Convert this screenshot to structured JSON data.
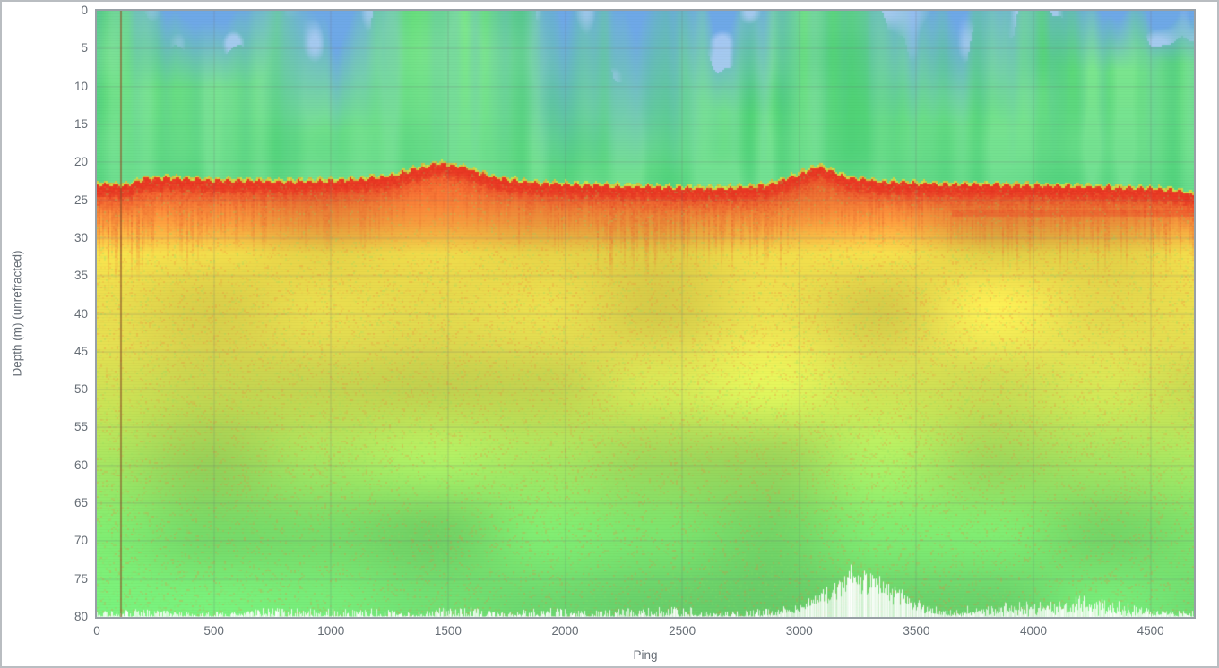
{
  "page": {
    "background": "#ffffff",
    "border_color": "#b9bdc1"
  },
  "chart_data": {
    "type": "heatmap",
    "subtype": "sonar-echogram",
    "title": "",
    "xlabel": "Ping",
    "ylabel": "Depth (m) (unrefracted)",
    "xlim": [
      0,
      4685
    ],
    "ylim": [
      0,
      80
    ],
    "y_axis_inverted": true,
    "grid": true,
    "legend": null,
    "x_ticks": [
      0,
      500,
      1000,
      1500,
      2000,
      2500,
      3000,
      3500,
      4000,
      4500
    ],
    "y_ticks": [
      0,
      5,
      10,
      15,
      20,
      25,
      30,
      35,
      40,
      45,
      50,
      55,
      60,
      65,
      70,
      75,
      80
    ],
    "marker_line": {
      "ping": 103,
      "color": "rgba(140,82,40,0.6)"
    },
    "seabed_profile": [
      [
        0,
        22.6
      ],
      [
        120,
        22.9
      ],
      [
        200,
        22.0
      ],
      [
        300,
        21.8
      ],
      [
        450,
        22.1
      ],
      [
        700,
        22.3
      ],
      [
        900,
        22.3
      ],
      [
        1100,
        22.1
      ],
      [
        1250,
        21.6
      ],
      [
        1450,
        19.9
      ],
      [
        1560,
        20.4
      ],
      [
        1700,
        21.9
      ],
      [
        1900,
        22.6
      ],
      [
        2100,
        22.8
      ],
      [
        2300,
        23.0
      ],
      [
        2500,
        23.2
      ],
      [
        2700,
        23.2
      ],
      [
        2850,
        22.9
      ],
      [
        2950,
        21.9
      ],
      [
        3080,
        20.3
      ],
      [
        3200,
        21.8
      ],
      [
        3350,
        22.4
      ],
      [
        3600,
        22.7
      ],
      [
        3900,
        22.8
      ],
      [
        4200,
        23.0
      ],
      [
        4450,
        23.2
      ],
      [
        4600,
        23.5
      ],
      [
        4685,
        24.0
      ]
    ],
    "water_blue_zones": [
      {
        "ping": 460,
        "sigma": 290,
        "reach_m": 10
      },
      {
        "ping": 995,
        "sigma": 210,
        "reach_m": 16
      },
      {
        "ping": 2160,
        "sigma": 360,
        "reach_m": 22
      },
      {
        "ping": 2680,
        "sigma": 230,
        "reach_m": 14
      },
      {
        "ping": 3615,
        "sigma": 325,
        "reach_m": 15
      },
      {
        "ping": 4290,
        "sigma": 230,
        "reach_m": 8
      },
      {
        "ping": 4590,
        "sigma": 310,
        "reach_m": 7
      }
    ],
    "subbottom_intensity_zones": [
      {
        "from": 0,
        "to": 450,
        "mult": 1.5
      },
      {
        "from": 2100,
        "to": 2950,
        "mult": 1.35
      },
      {
        "from": 3850,
        "to": 4685,
        "mult": 1.3
      }
    ],
    "deep_reflector": {
      "ping_from": 3650,
      "ping_to": 4680,
      "depth_m": 26.6
    },
    "bottom_noise": {
      "base_m": 1.6,
      "hump": {
        "ping": 3250,
        "sigma": 200,
        "max_m": 6.2
      },
      "secondary": {
        "ping": 4100,
        "sigma": 340,
        "max_m": 1.9
      }
    },
    "colors": {
      "water_green_dark": "#4cd36c",
      "water_green_light": "#7ee88c",
      "water_teal": "#55cfa2",
      "water_blue": "#6fa9e8",
      "water_light_blue": "#aecdf6",
      "seabed_fringe": "#cdea4b",
      "seabed_red": "#ee3a26",
      "seabed_red_dark": "#d83018",
      "seabed_orange": "#f28038",
      "speckle_green": "#86dd62",
      "noise_white": "#ffffff",
      "depth_ramp": [
        [
          24,
          "#ef6f33"
        ],
        [
          28,
          "#f19a3d"
        ],
        [
          32,
          "#ecd84a"
        ],
        [
          44,
          "#e6e052"
        ],
        [
          52,
          "#cbe557"
        ],
        [
          60,
          "#a2e361"
        ],
        [
          68,
          "#7ce26c"
        ],
        [
          80,
          "#6ede74"
        ]
      ],
      "grid": "rgba(106,112,118,0.28)",
      "scanline": "rgba(0,0,0,0.022)",
      "frame": "#98a0a6",
      "tick_text": "#666d75"
    }
  }
}
